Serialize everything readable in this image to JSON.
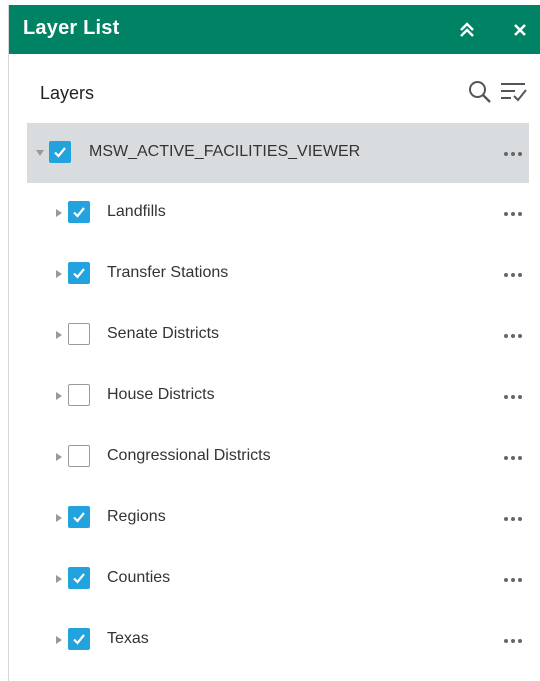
{
  "panel": {
    "title": "Layer List",
    "accent_color": "#008364",
    "checkbox_color": "#22a3dd"
  },
  "header": {
    "title": "Layers"
  },
  "layers": [
    {
      "label": "MSW_ACTIVE_FACILITIES_VIEWER",
      "checked": true,
      "expanded": true,
      "level": 0
    },
    {
      "label": "Landfills",
      "checked": true,
      "expanded": false,
      "level": 1
    },
    {
      "label": "Transfer Stations",
      "checked": true,
      "expanded": false,
      "level": 1
    },
    {
      "label": "Senate Districts",
      "checked": false,
      "expanded": false,
      "level": 1
    },
    {
      "label": "House Districts",
      "checked": false,
      "expanded": false,
      "level": 1
    },
    {
      "label": "Congressional Districts",
      "checked": false,
      "expanded": false,
      "level": 1
    },
    {
      "label": "Regions",
      "checked": true,
      "expanded": false,
      "level": 1
    },
    {
      "label": "Counties",
      "checked": true,
      "expanded": false,
      "level": 1
    },
    {
      "label": "Texas",
      "checked": true,
      "expanded": false,
      "level": 1
    }
  ]
}
